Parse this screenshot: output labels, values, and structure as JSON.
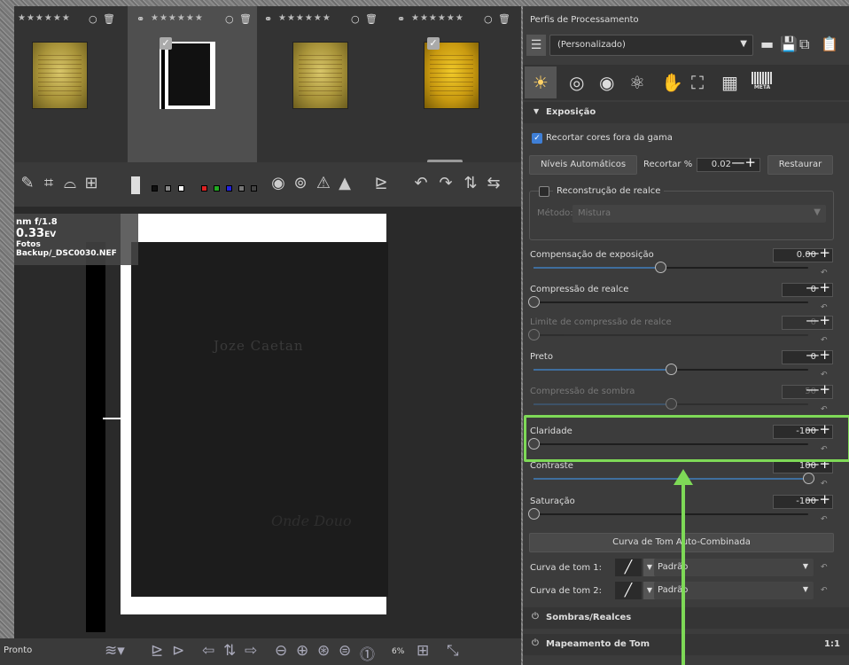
{
  "filmstrip": {
    "thumbs": [
      {
        "stars": "★★★★★★",
        "selected": false
      },
      {
        "stars": "★★★★★★",
        "selected": true
      },
      {
        "stars": "★★★★★★",
        "selected": false
      },
      {
        "stars": "★★★★★★",
        "selected": false
      }
    ]
  },
  "viewer": {
    "info_line1": "nm f/1.8",
    "info_line2": "0.33",
    "info_unit": "EV",
    "info_file": "Fotos Backup/_DSC0030.NEF",
    "doc_text_1": "Joze Caetan",
    "doc_text_2": "Onde Douo"
  },
  "status": {
    "text": "Pronto",
    "zoom": "6%"
  },
  "panel": {
    "profiles_title": "Perfis de Processamento",
    "profile_value": "(Personalizado)",
    "meta_label": "META",
    "exposure_section": "Exposição",
    "clip_label": "Recortar cores fora da gama",
    "auto_levels": "Níveis Automáticos",
    "clip_pct_label": "Recortar %",
    "clip_pct_value": "0.02",
    "restore": "Restaurar",
    "highlight_recon": "Reconstrução de realce",
    "method_label": "Método:",
    "method_value": "Mistura",
    "sliders": [
      {
        "label": "Compensação de exposição",
        "value": "0.00",
        "level": 0.46,
        "enabled": true
      },
      {
        "label": "Compressão de realce",
        "value": "0",
        "level": 0.0,
        "enabled": true
      },
      {
        "label": "Limite de compressão de realce",
        "value": "0",
        "level": 0.0,
        "enabled": false
      },
      {
        "label": "Preto",
        "value": "0",
        "level": 0.5,
        "enabled": true
      },
      {
        "label": "Compressão de sombra",
        "value": "50",
        "level": 0.5,
        "enabled": false
      },
      {
        "label": "Claridade",
        "value": "-100",
        "level": 0.0,
        "enabled": true
      },
      {
        "label": "Contraste",
        "value": "100",
        "level": 1.0,
        "enabled": true
      },
      {
        "label": "Saturação",
        "value": "-100",
        "level": 0.0,
        "enabled": true
      }
    ],
    "tone_curve_auto": "Curva de Tom Auto-Combinada",
    "tone1_label": "Curva de tom 1:",
    "tone2_label": "Curva de tom 2:",
    "tone_mode": "Padrão",
    "shadows_section": "Sombras/Realces",
    "tonemap_section": "Mapeamento de Tom",
    "ratio": "1:1"
  },
  "colors": {
    "accent": "#7ed957",
    "slider_fill": "#3f6e9e"
  }
}
